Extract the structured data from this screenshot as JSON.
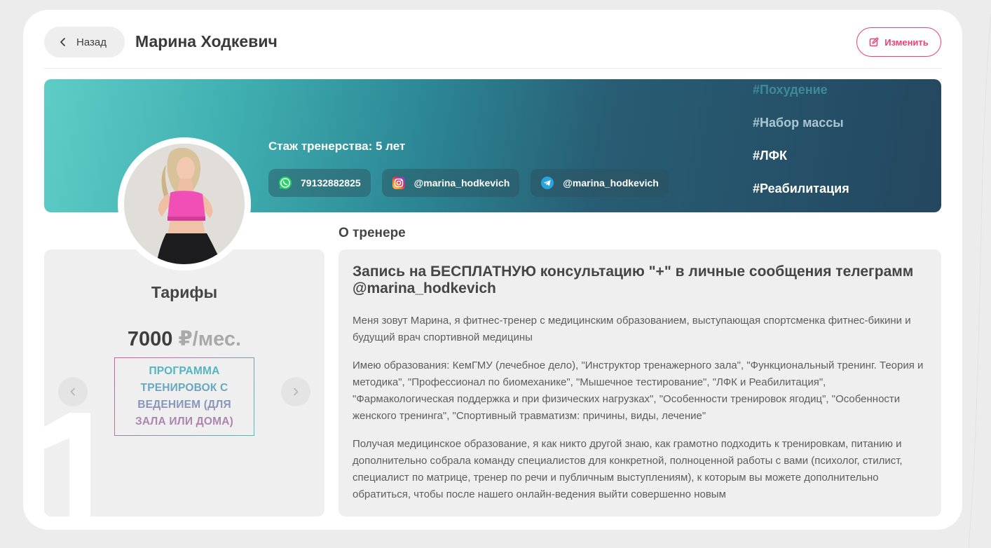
{
  "header": {
    "back_label": "Назад",
    "title": "Марина Ходкевич",
    "edit_label": "Изменить"
  },
  "banner": {
    "experience": "Стаж тренерства: 5 лет",
    "contacts": [
      {
        "icon": "whatsapp-icon",
        "label": "79132882825"
      },
      {
        "icon": "instagram-icon",
        "label": "@marina_hodkevich"
      },
      {
        "icon": "telegram-icon",
        "label": "@marina_hodkevich"
      }
    ],
    "tags": [
      {
        "label": "#Похудение",
        "color": "#3f8a97"
      },
      {
        "label": "#Набор массы",
        "color": "#a8c7d0"
      },
      {
        "label": "#ЛФК",
        "color": "#ffffff"
      },
      {
        "label": "#Реабилитация",
        "color": "#ffffff"
      }
    ]
  },
  "tariffs": {
    "title": "Тарифы",
    "price_value": "7000",
    "price_unit": "₽/мес.",
    "plan_label": "ПРОГРАММА ТРЕНИРОВОК С ВЕДЕНИЕМ (ДЛЯ ЗАЛА ИЛИ ДОМА)"
  },
  "about": {
    "heading": "О тренере",
    "headline": "Запись на БЕСПЛАТНУЮ консультацию \"+\" в личные сообщения телеграмм @marina_hodkevich",
    "paragraphs": [
      "Меня зовут Марина, я фитнес-тренер с медицинским образованием, выступающая спортсменка фитнес-бикини и будущий врач спортивной медицины",
      "Имею образования: КемГМУ (лечебное дело), \"Инструктор тренажерного зала\", \"Функциональный тренинг. Теория и методика\", \"Профессионал по биомеханике\", \"Мышечное тестирование\", \"ЛФК и Реабилитация\", \"Фармакологическая поддержка и при физических нагрузках\", \"Особенности тренировок ягодиц\", \"Особенности женского тренинга\", \"Спортивный травматизм: причины, виды, лечение\"",
      "Получая медицинское образование, я как никто другой знаю, как грамотно подходить к тренировкам, питанию и дополнительно собрала команду специалистов для конкретной, полноценной работы с вами (психолог, стилист, специалист по матрице, тренер по речи и публичным выступлениям), к которым вы можете дополнительно обратиться, чтобы после нашего онлайн-ведения выйти совершенно новым"
    ]
  },
  "colors": {
    "accent": "#ee3f74",
    "banner_start": "#5ecdc6",
    "banner_end": "#23475f",
    "panel_bg": "#efefef"
  }
}
